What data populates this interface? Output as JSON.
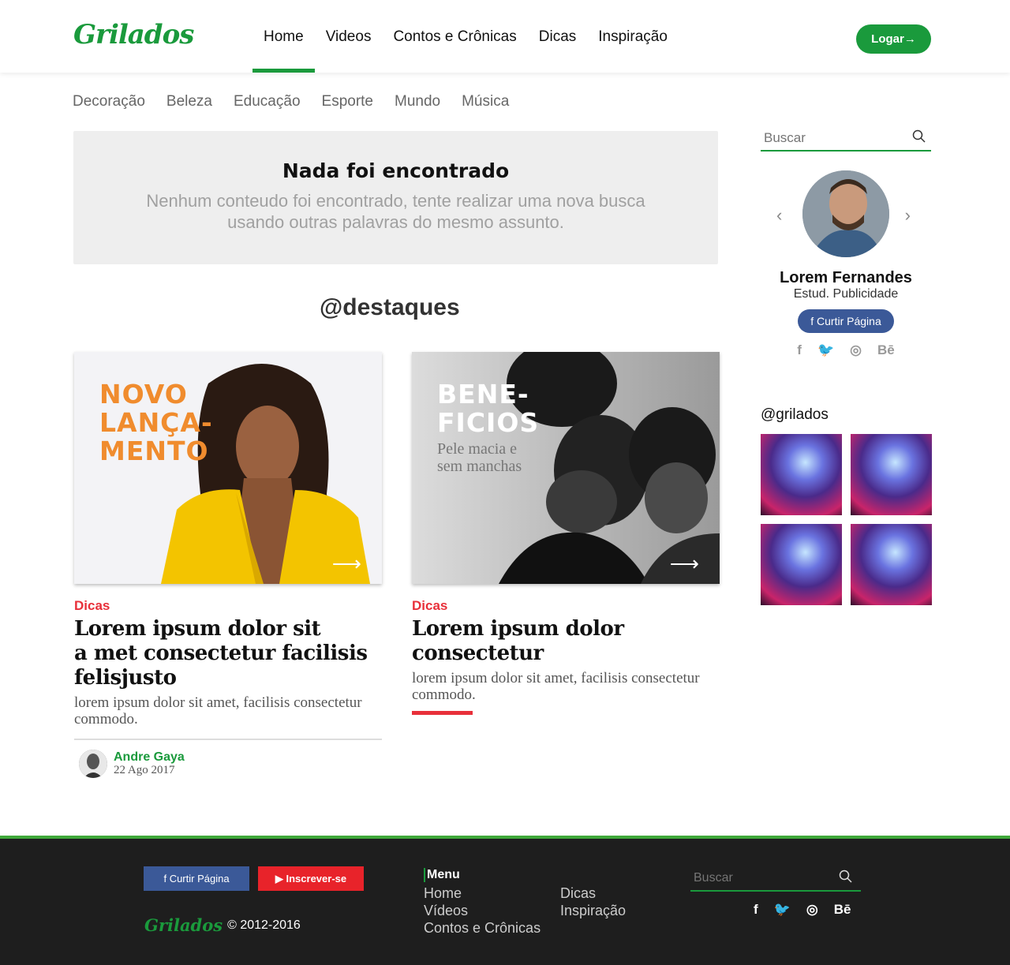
{
  "brand": {
    "logo_text": "Grilados",
    "accent_color": "#1a9a3c"
  },
  "header": {
    "nav": [
      "Home",
      "Videos",
      "Contos e Crônicas",
      "Dicas",
      "Inspiração"
    ],
    "active": "Home",
    "login_label": "Logar"
  },
  "categories": [
    "Decoração",
    "Beleza",
    "Educação",
    "Esporte",
    "Mundo",
    "Música"
  ],
  "empty_state": {
    "title": "Nada foi encontrado",
    "text": "Nenhum conteudo foi encontrado, tente realizar uma nova busca usando outras palavras do mesmo assunto."
  },
  "highlights_title": "@destaques",
  "cards": [
    {
      "overlay": "NOVO LANÇA- MENTO",
      "category": "Dicas",
      "title": "Lorem ipsum dolor sit a met consectetur facilisis felisjusto",
      "desc": "lorem ipsum dolor sit amet, facilisis consectetur commodo.",
      "author_name": "Andre Gaya",
      "author_date": "22 Ago 2017"
    },
    {
      "overlay": "BENE- FICIOS",
      "overlay_sub": "Pele macia e sem manchas",
      "category": "Dicas",
      "title": "Lorem ipsum dolor consectetur",
      "desc": "lorem ipsum dolor sit amet, facilisis consectetur commodo."
    }
  ],
  "sidebar": {
    "search_placeholder": "Buscar",
    "profile_name": "Lorem Fernandes",
    "profile_role": "Estud. Publicidade",
    "like_label": "Curtir Página",
    "social_icons": [
      "facebook-icon",
      "twitter-icon",
      "instagram-icon",
      "behance-icon"
    ],
    "instagram_title": "@grilados"
  },
  "footer": {
    "fb_label": "Curtir Página",
    "yt_label": "Inscrever-se",
    "copyright": "© 2012-2016",
    "menu_heading": "Menu",
    "menu_col1": [
      "Home",
      "Vídeos",
      "Contos e Crônicas"
    ],
    "menu_col2": [
      "Dicas",
      "Inspiração"
    ],
    "search_placeholder": "Buscar"
  }
}
